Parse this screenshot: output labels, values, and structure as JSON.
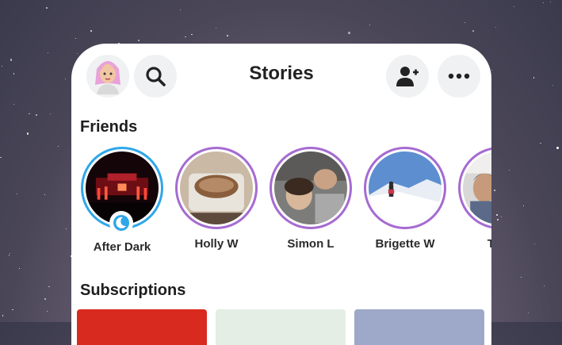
{
  "header": {
    "title": "Stories",
    "avatar_icon": "bitmoji-avatar",
    "search_icon": "search-icon",
    "add_friend_icon": "add-friend-icon",
    "more_icon": "more-options-icon"
  },
  "friends": {
    "section_title": "Friends",
    "stories": [
      {
        "label": "After Dark",
        "ring_color": "#2fa7e8",
        "badge_icon": "moon-icon"
      },
      {
        "label": "Holly W",
        "ring_color": "#a66bd1"
      },
      {
        "label": "Simon L",
        "ring_color": "#a66bd1"
      },
      {
        "label": "Brigette W",
        "ring_color": "#a66bd1"
      },
      {
        "label": "Tom",
        "ring_color": "#a66bd1"
      }
    ]
  },
  "subscriptions": {
    "section_title": "Subscriptions"
  },
  "colors": {
    "accent_purple": "#a66bd1",
    "accent_blue": "#2fa7e8"
  }
}
